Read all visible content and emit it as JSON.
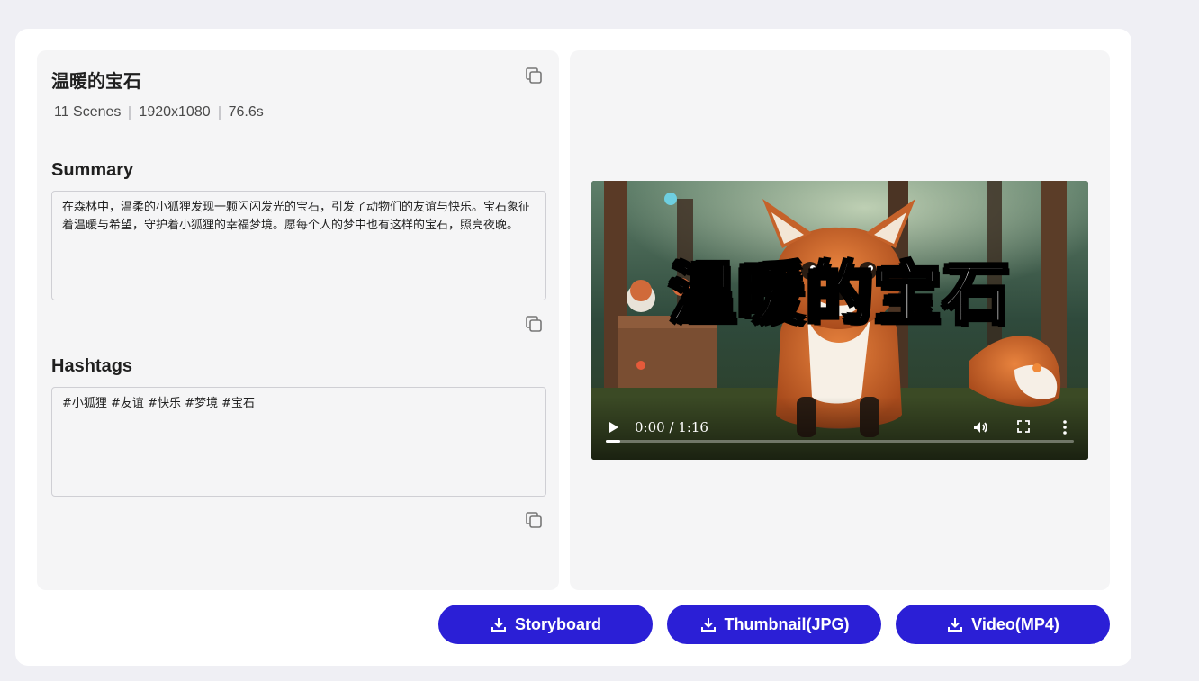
{
  "project": {
    "title": "温暖的宝石",
    "scenes": "11 Scenes",
    "resolution": "1920x1080",
    "duration": "76.6s"
  },
  "summary": {
    "heading": "Summary",
    "text": "在森林中，温柔的小狐狸发现一颗闪闪发光的宝石，引发了动物们的友谊与快乐。宝石象征着温暖与希望，守护着小狐狸的幸福梦境。愿每个人的梦中也有这样的宝石，照亮夜晚。"
  },
  "hashtags": {
    "heading": "Hashtags",
    "text": "#小狐狸 #友谊 #快乐 #梦境 #宝石"
  },
  "video": {
    "overlay_title": "温暖的宝石",
    "time_display": "0:00 / 1:16",
    "progress_fraction": 0.03
  },
  "actions": {
    "storyboard": "Storyboard",
    "thumbnail": "Thumbnail(JPG)",
    "video": "Video(MP4)"
  },
  "colors": {
    "accent": "#2b1fd6",
    "page_bg": "#efeff4",
    "panel_bg": "#f5f5f6"
  },
  "icons": [
    "copy-icon",
    "play-icon",
    "volume-icon",
    "fullscreen-icon",
    "more-vertical-icon",
    "download-icon"
  ]
}
